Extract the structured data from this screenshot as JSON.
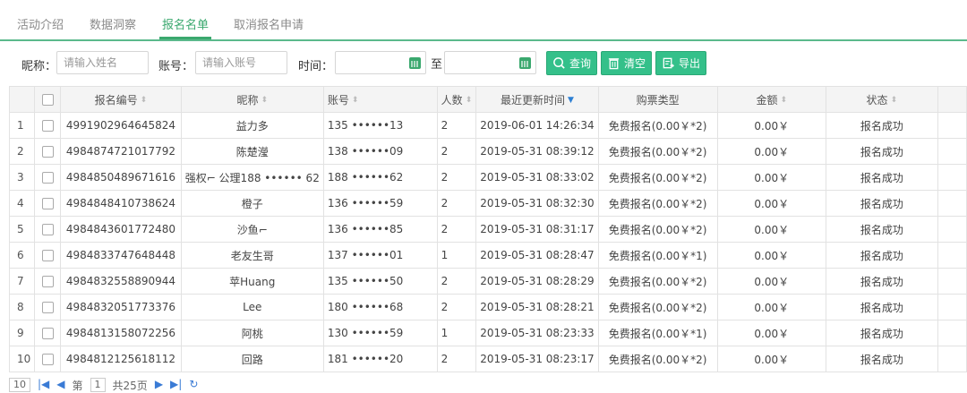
{
  "tabs": [
    {
      "label": "活动介绍",
      "active": false
    },
    {
      "label": "数据洞察",
      "active": false
    },
    {
      "label": "报名名单",
      "active": true
    },
    {
      "label": "取消报名申请",
      "active": false
    }
  ],
  "filters": {
    "nickname_label": "昵称：",
    "nickname_placeholder": "请输入姓名",
    "account_label": "账号：",
    "account_placeholder": "请输入账号",
    "time_label": "时间：",
    "to_label": "至"
  },
  "buttons": {
    "query": "查询",
    "clear": "清空",
    "export": "导出"
  },
  "table": {
    "columns": [
      "报名编号",
      "昵称",
      "账号",
      "人数",
      "最近更新时间",
      "购票类型",
      "金额",
      "状态"
    ],
    "rows": [
      {
        "index": "1",
        "id": "4991902964645824",
        "nick": "益力多",
        "account": "135 ••••••13",
        "count": "2",
        "time": "2019-06-01 14:26:34",
        "type": "免费报名(0.00￥*2)",
        "amount": "0.00￥",
        "status": "报名成功"
      },
      {
        "index": "2",
        "id": "4984874721017792",
        "nick": "陈楚瀅",
        "account": "138 ••••••09",
        "count": "2",
        "time": "2019-05-31 08:39:12",
        "type": "免费报名(0.00￥*2)",
        "amount": "0.00￥",
        "status": "报名成功"
      },
      {
        "index": "3",
        "id": "4984850489671616",
        "nick": "强权⌐ 公理188 •••••• 62",
        "account": "188 ••••••62",
        "count": "2",
        "time": "2019-05-31 08:33:02",
        "type": "免费报名(0.00￥*2)",
        "amount": "0.00￥",
        "status": "报名成功"
      },
      {
        "index": "4",
        "id": "4984848410738624",
        "nick": "橙子",
        "account": "136 ••••••59",
        "count": "2",
        "time": "2019-05-31 08:32:30",
        "type": "免费报名(0.00￥*2)",
        "amount": "0.00￥",
        "status": "报名成功"
      },
      {
        "index": "5",
        "id": "4984843601772480",
        "nick": "沙鱼⌐",
        "account": "136 ••••••85",
        "count": "2",
        "time": "2019-05-31 08:31:17",
        "type": "免费报名(0.00￥*2)",
        "amount": "0.00￥",
        "status": "报名成功"
      },
      {
        "index": "6",
        "id": "4984833747648448",
        "nick": "老友生哥",
        "account": "137 ••••••01",
        "count": "1",
        "time": "2019-05-31 08:28:47",
        "type": "免费报名(0.00￥*1)",
        "amount": "0.00￥",
        "status": "报名成功"
      },
      {
        "index": "7",
        "id": "4984832558890944",
        "nick": "苹Huang",
        "account": "135 ••••••50",
        "count": "2",
        "time": "2019-05-31 08:28:29",
        "type": "免费报名(0.00￥*2)",
        "amount": "0.00￥",
        "status": "报名成功"
      },
      {
        "index": "8",
        "id": "4984832051773376",
        "nick": "Lee",
        "account": "180 ••••••68",
        "count": "2",
        "time": "2019-05-31 08:28:21",
        "type": "免费报名(0.00￥*2)",
        "amount": "0.00￥",
        "status": "报名成功"
      },
      {
        "index": "9",
        "id": "4984813158072256",
        "nick": "阿桃",
        "account": "130 ••••••59",
        "count": "1",
        "time": "2019-05-31 08:23:33",
        "type": "免费报名(0.00￥*1)",
        "amount": "0.00￥",
        "status": "报名成功"
      },
      {
        "index": "10",
        "id": "4984812125618112",
        "nick": "回路",
        "account": "181 ••••••20",
        "count": "2",
        "time": "2019-05-31 08:23:17",
        "type": "免费报名(0.00￥*2)",
        "amount": "0.00￥",
        "status": "报名成功"
      }
    ]
  },
  "pager": {
    "page_size": "10",
    "page_prefix": "第",
    "current_page": "1",
    "total_pages": "共25页"
  },
  "colors": {
    "accent": "#3aa86e",
    "button": "#34c08a",
    "sort_active": "#2d7fd3"
  }
}
